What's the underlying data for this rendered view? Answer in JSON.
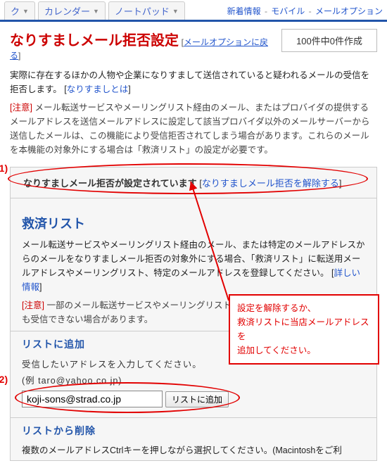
{
  "tabs": {
    "t1": "ク",
    "t2": "カレンダー",
    "t3": "ノートパッド"
  },
  "toplinks": {
    "new": "新着情報",
    "mobile": "モバイル",
    "mailopt": "メールオプション"
  },
  "title": "なりすましメール拒否設定",
  "back_link": "メールオプションに戻る",
  "count_box": "100件中0件作成",
  "intro": "実際に存在するほかの人物や企業になりすまして送信されていると疑われるメールの受信を拒否します。",
  "intro_link": "なりすましとは",
  "caution_label": "[注意]",
  "caution_body": "メール転送サービスやメーリングリスト経由のメール、またはプロバイダの提供するメールアドレスを送信メールアドレスに設定して該当プロバイダ以外のメールサーバーから送信したメールは、この機能により受信拒否されてしまう場合があります。これらのメールを本機能の対象外にする場合は「救済リスト」の設定が必要です。",
  "status_text": "なりすましメール拒否が設定されています",
  "status_link": "なりすましメール拒否を解除する",
  "rescue_title": "救済リスト",
  "rescue_body": "メール転送サービスやメーリングリスト経由のメール、または特定のメールアドレスからのメールをなりすましメール拒否の対象外にする場合、「救済リスト」に転送用メールアドレスやメーリングリスト、特定のメールアドレスを登録してください。",
  "rescue_more": "詳しい情報",
  "rescue_warn": "一部のメール転送サービスやメーリングリストでは、「救済リスト」に登録しても受信できない場合があります。",
  "add_title": "リストに追加",
  "add_prompt": "受信したいアドレスを入力してください。",
  "add_example": "(例 taro@yahoo.co.jp)",
  "add_value": "koji-sons@strad.co.jp",
  "add_button": "リストに追加",
  "del_title": "リストから削除",
  "del_body": "複数のメールアドレスCtrlキーを押しながら選択してください。(Macintoshをご利",
  "callout_l1": "設定を解除するか、",
  "callout_l2": "救済リストに当店メールアドレスを",
  "callout_l3": "追加してください。",
  "anno1": "(1)",
  "anno2": "(2)"
}
